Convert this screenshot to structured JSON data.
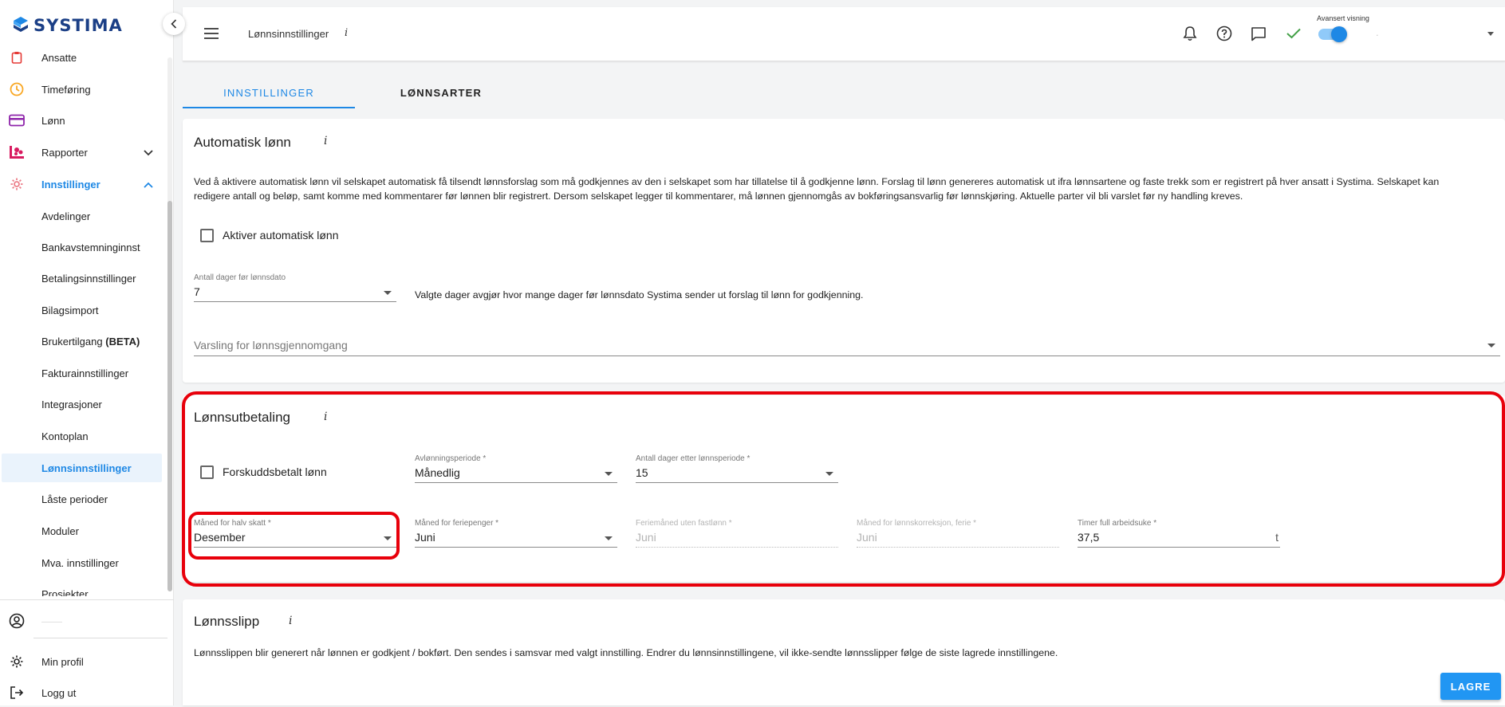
{
  "brand": {
    "name": "SYSTIMA",
    "color": "#1b3f86"
  },
  "colors": {
    "accent": "#1e88e5",
    "highlight": "#e8000b",
    "button": "#2196f3"
  },
  "sidebar": {
    "items": [
      {
        "label": "Ansatte",
        "icon": "clipboard-icon"
      },
      {
        "label": "Timeføring",
        "icon": "clock-icon"
      },
      {
        "label": "Lønn",
        "icon": "credit-card-icon"
      },
      {
        "label": "Rapporter",
        "icon": "report-chart-icon"
      },
      {
        "label": "Innstillinger",
        "icon": "gear-icon"
      }
    ],
    "sub_items": [
      "Avdelinger",
      "Bankavstemninginnst",
      "Betalingsinnstillinger",
      "Bilagsimport",
      "Brukertilgang",
      "Fakturainnstillinger",
      "Integrasjoner",
      "Kontoplan",
      "Lønnsinnstillinger",
      "Låste perioder",
      "Moduler",
      "Mva. innstillinger",
      "Prosjekter"
    ],
    "beta_badge": "(BETA)",
    "user_name": "——",
    "profile_label": "Min profil",
    "logout_label": "Logg ut"
  },
  "header": {
    "title": "Lønnsinnstillinger",
    "info": "i",
    "advanced_view_label": "Avansert visning",
    "advanced_view_on": true,
    "company_name": "."
  },
  "tabs": [
    {
      "label": "INNSTILLINGER",
      "active": true
    },
    {
      "label": "LØNNSARTER",
      "active": false
    }
  ],
  "auto_salary": {
    "title": "Automatisk lønn",
    "info": "i",
    "description_line1": "Ved å aktivere automatisk lønn vil selskapet automatisk få tilsendt lønnsforslag som må godkjennes av den i selskapet som har tillatelse til å godkjenne lønn. Forslag til lønn genereres automatisk ut ifra lønnsartene og faste trekk som er registrert på hver ansatt i Systima. Selskapet kan",
    "description_line2": "redigere antall og beløp, samt komme med kommentarer før lønnen blir registrert. Dersom selskapet legger til kommentarer, må lønnen gjennomgås av bokføringsansvarlig før lønnskjøring. Aktuelle parter vil bli varslet før ny handling kreves.",
    "checkbox_label": "Aktiver automatisk lønn",
    "checkbox_checked": false,
    "days_label": "Antall dager før lønnsdato",
    "days_value": "7",
    "days_help": "Valgte dager avgjør hvor mange dager før lønnsdato Systima sender ut forslag til lønn for godkjenning.",
    "notify_placeholder": "Varsling for lønnsgjennomgang"
  },
  "payout": {
    "title": "Lønnsutbetaling",
    "info": "i",
    "prepaid_label": "Forskuddsbetalt lønn",
    "prepaid_checked": false,
    "period_label": "Avlønningsperiode *",
    "period_value": "Månedlig",
    "days_after_label": "Antall dager etter lønnsperiode *",
    "days_after_value": "15",
    "half_tax_label": "Måned for halv skatt *",
    "half_tax_value": "Desember",
    "holiday_pay_label": "Måned for feriepenger *",
    "holiday_pay_value": "Juni",
    "holiday_month_label": "Feriemåned uten fastlønn *",
    "holiday_month_value": "Juni",
    "correction_label": "Måned for lønnskorreksjon, ferie *",
    "correction_value": "Juni",
    "hours_label": "Timer full arbeidsuke *",
    "hours_value": "37,5",
    "hours_unit": "t"
  },
  "payslip": {
    "title": "Lønnsslipp",
    "info": "i",
    "description": "Lønnsslippen blir generert når lønnen er godkjent / bokført. Den sendes i samsvar med valgt innstilling. Endrer du lønnsinnstillingene, vil ikke-sendte lønnsslipper følge de siste lagrede innstillingene."
  },
  "save_label": "LAGRE"
}
